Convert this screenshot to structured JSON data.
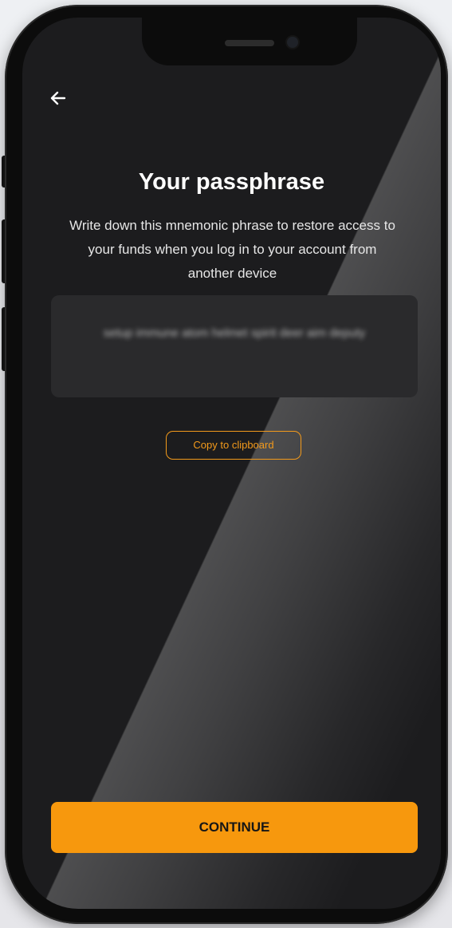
{
  "header": {
    "back_icon": "arrow-left-icon"
  },
  "main": {
    "title": "Your passphrase",
    "subtitle": "Write down this mnemonic phrase to restore access to your funds when you log in to your account from another device",
    "phrase": "setup immune atom helmet spirit deer aim deputy",
    "copy_label": "Copy to clipboard"
  },
  "footer": {
    "continue_label": "CONTINUE"
  },
  "colors": {
    "accent": "#f7980d",
    "background": "#1c1c1e",
    "phrase_box": "#2a2a2c"
  }
}
